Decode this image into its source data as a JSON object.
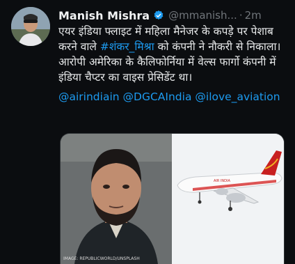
{
  "tweet": {
    "author_name": "Manish Mishra",
    "author_handle": "@mmanish...",
    "dot": "·",
    "time": "2m",
    "line1": "एयर इंडिया फ्लाइट में महिला मैनेजर के कपड़े पर पेशाब करने वाले ",
    "hashtag": "#शंकर_मिश्रा",
    "line1_tail": " को कंपनी ने नौकरी से निकाला।",
    "line2": "आरोपी अमेरिका के कैलिफोर्निया में वेल्स फार्गो कंपनी में इंडिया चैप्टर का वाइस प्रेसिडेंट था।",
    "mentions": [
      "@airindiain",
      "@DGCAIndia",
      "@ilove_aviation"
    ]
  },
  "media": {
    "left_image": "man-portrait",
    "right_image": "air-india-airplane",
    "credit": "IMAGE: REPUBLICWORLD/UNSPLASH"
  },
  "colors": {
    "background": "#0b0d10",
    "link": "#1d9bf0",
    "verified": "#1d9bf0",
    "muted": "#71767b"
  }
}
